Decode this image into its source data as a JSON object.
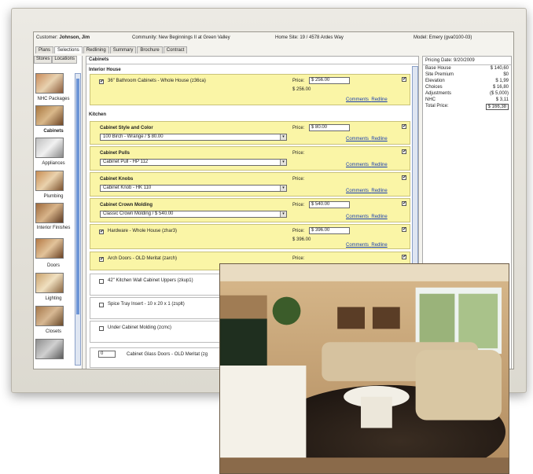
{
  "info": {
    "customer_label": "Customer:",
    "customer": "Johnson, Jim",
    "community": "Community: New Beginnings II at Green Valley",
    "home_site": "Home Site: 19 / 4578 Ardes Way",
    "model": "Model: Emery (gva0100-03)"
  },
  "tabs": [
    "Plans",
    "Selections",
    "Redlining",
    "Summary",
    "Brochure",
    "Contract"
  ],
  "active_tab": "Selections",
  "left": {
    "subtabs": [
      "Stores",
      "Locations"
    ],
    "categories": [
      "NHC Packages",
      "Cabinets",
      "Appliances",
      "Plumbing",
      "Interior Finishes",
      "Doors",
      "Lighting",
      "Closets"
    ]
  },
  "main": {
    "header": "Cabinets",
    "section_interior": "Interior House",
    "section_kitchen": "Kitchen",
    "price_label": "Price:",
    "comments": "Comments",
    "redline": "Redline",
    "items": {
      "bath": {
        "title": "36\" Bathroom Cabinets - Whole House (z36ca)",
        "price": "$ 256.00",
        "sub": "$ 256.00"
      },
      "style": {
        "title": "Cabinet Style and Color",
        "price": "$ 80.00",
        "select": "100 Birch - Wrange / $ 80.00"
      },
      "pulls": {
        "title": "Cabinet Pulls",
        "select": "Cabinet Pull - HP 112"
      },
      "knobs": {
        "title": "Cabinet Knobs",
        "select": "Cabinet Knob - HK 110"
      },
      "crown": {
        "title": "Cabinet Crown Molding",
        "price": "$ 540.00",
        "select": "Classic Crown Molding / $ 540.00"
      },
      "hardware": {
        "title": "Hardware - Whole House (zhar3)",
        "price": "$ 396.00",
        "sub": "$ 396.00"
      },
      "arch": {
        "title": "Arch Doors - OLD Meritat (zarch)"
      },
      "uppers": {
        "title": "42\" Kitchen Wall Cabinet Uppers (zkup1)"
      },
      "spice": {
        "title": "Spice Tray Insert - 10 x 20 x 1 (zsplt)"
      },
      "undercab": {
        "title": "Under Cabinet Molding (zcmc)"
      },
      "glass": {
        "qty": "0",
        "title": "Cabinet Glass Doors - OLD Meritat (zg"
      }
    }
  },
  "pricing": {
    "header": "Pricing   Date: 9/20/2009",
    "rows": [
      {
        "label": "Base House",
        "value": "$ 140,60"
      },
      {
        "label": "Site Premium",
        "value": "$0"
      },
      {
        "label": "Elevation",
        "value": "$ 1,99"
      },
      {
        "label": "Choices",
        "value": "$ 16,80"
      },
      {
        "label": "Adjustments",
        "value": "($ 5,000)"
      },
      {
        "label": "NHC",
        "value": "$ 3,11"
      }
    ],
    "total_label": "Total Price:",
    "total_value": "$ 166,38"
  },
  "colors": {
    "item_fill": "#faf5a6",
    "link": "#1a3fb0",
    "scroll": "#6d95d6"
  }
}
